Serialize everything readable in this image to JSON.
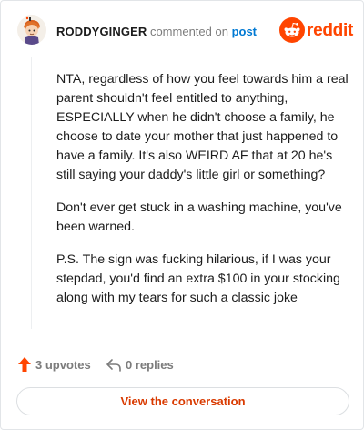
{
  "header": {
    "username": "RODDYGINGER",
    "action_text": " commented on ",
    "post_link": "post",
    "brand_word": "reddit",
    "brand_color": "#ff4500"
  },
  "comment": {
    "paragraphs": [
      "NTA, regardless of how you feel towards him a real parent shouldn't feel entitled to anything, ESPECIALLY when he didn't choose a family, he choose to date your mother that just happened to have a family. It's also WEIRD AF that at 20 he's still saying your daddy's little girl or something?",
      "Don't ever get stuck in a washing machine, you've been warned.",
      "P.S. The sign was fucking hilarious, if I was your stepdad, you'd find an extra $100 in your stocking along with my tears for such a classic joke"
    ]
  },
  "footer": {
    "upvotes": "3 upvotes",
    "replies": "0 replies",
    "upvote_icon": "upvote-arrow-icon",
    "reply_icon": "reply-arrow-icon",
    "upvote_color": "#ff4500"
  },
  "cta": {
    "label": "View the conversation",
    "color": "#d93a00"
  }
}
